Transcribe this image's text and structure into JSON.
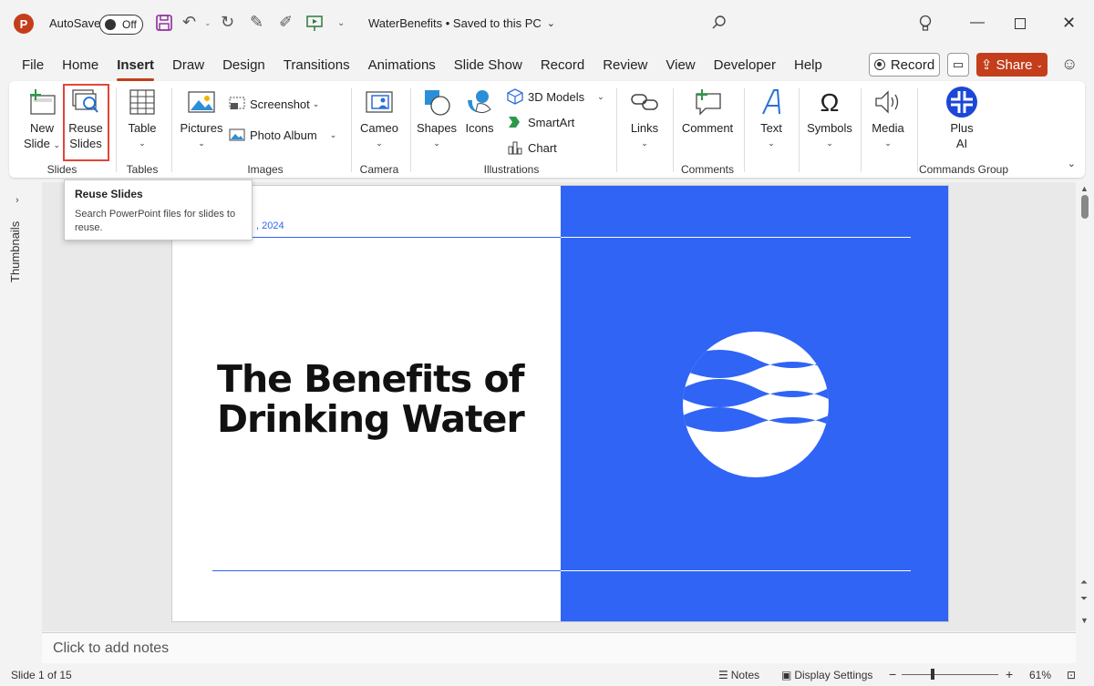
{
  "titlebar": {
    "app_logo": "P",
    "autosave_label": "AutoSave",
    "autosave_state": "Off",
    "document_title": "WaterBenefits • Saved to this PC",
    "icons": [
      "save-icon",
      "undo-icon",
      "redo-icon",
      "pen-icon",
      "highlighter-icon",
      "present-icon",
      "customize-icon",
      "search-icon",
      "lightbulb-icon",
      "minimize-icon",
      "maximize-icon",
      "close-icon"
    ]
  },
  "tabs": [
    "File",
    "Home",
    "Insert",
    "Draw",
    "Design",
    "Transitions",
    "Animations",
    "Slide Show",
    "Record",
    "Review",
    "View",
    "Developer",
    "Help"
  ],
  "active_tab": "Insert",
  "record_label": "Record",
  "share_label": "Share",
  "ribbon": {
    "new_slide": [
      "New",
      "Slide"
    ],
    "reuse_slides": [
      "Reuse",
      "Slides"
    ],
    "table": "Table",
    "pictures": "Pictures",
    "screenshot": "Screenshot",
    "photo_album": "Photo Album",
    "cameo": "Cameo",
    "shapes": "Shapes",
    "icons": "Icons",
    "models_3d": "3D Models",
    "smartart": "SmartArt",
    "chart": "Chart",
    "links": "Links",
    "comment": "Comment",
    "text": "Text",
    "symbols": "Symbols",
    "media": "Media",
    "plus_ai": [
      "Plus",
      "AI"
    ],
    "groups": {
      "slides": "Slides",
      "tables": "Tables",
      "images": "Images",
      "camera": "Camera",
      "illustrations": "Illustrations",
      "comments": "Comments",
      "commands": "Commands Group"
    },
    "plus_ai_color": "#1a47d6",
    "highlight_color": "#e0463a"
  },
  "tooltip": {
    "title": "Reuse Slides",
    "description": "Search PowerPoint files for slides to reuse."
  },
  "thumbnails_label": "Thumbnails",
  "slide": {
    "date": ", 2024",
    "title": "The Benefits of Drinking Water",
    "accent_color": "#2f64f5"
  },
  "notes_placeholder": "Click to add notes",
  "statusbar": {
    "slide_info": "Slide 1 of 15",
    "notes": "Notes",
    "display_settings": "Display Settings",
    "zoom": "61%"
  }
}
